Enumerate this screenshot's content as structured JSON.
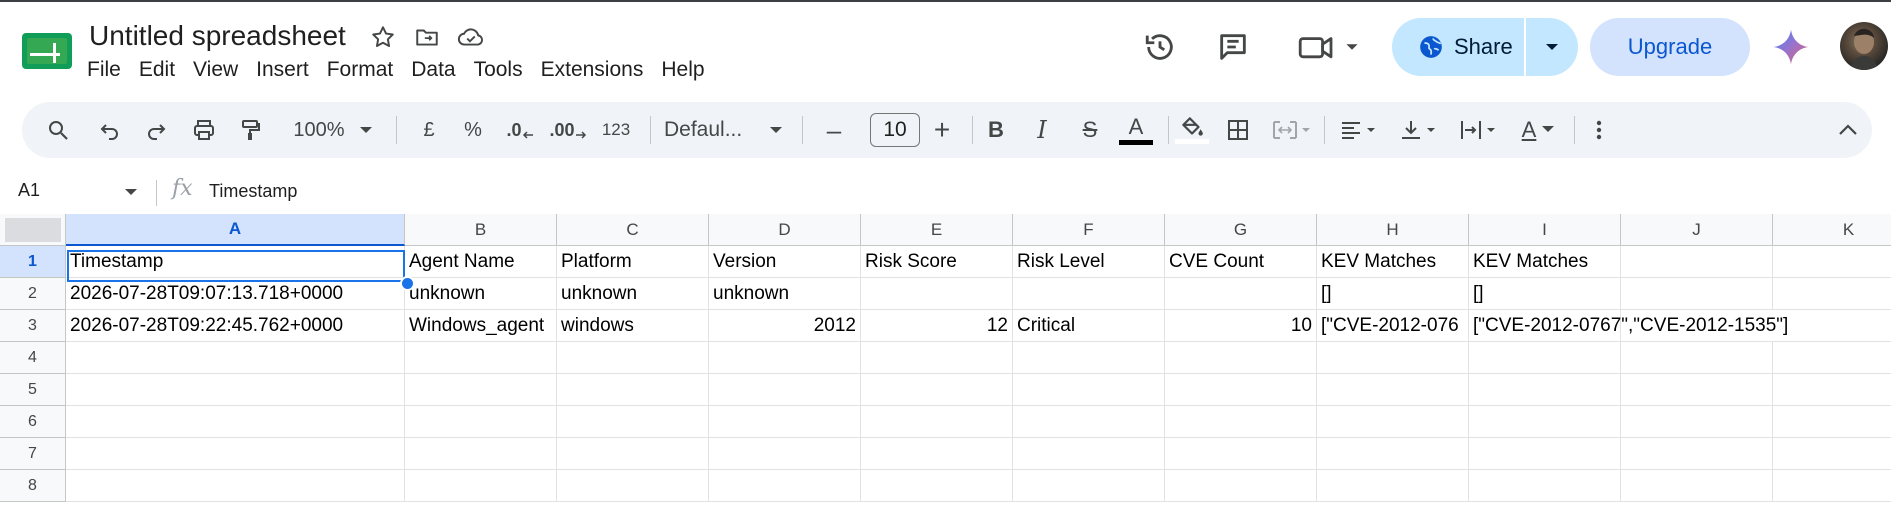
{
  "app": {
    "doc_title": "Untitled spreadsheet",
    "menu": [
      "File",
      "Edit",
      "View",
      "Insert",
      "Format",
      "Data",
      "Tools",
      "Extensions",
      "Help"
    ],
    "share_label": "Share",
    "upgrade_label": "Upgrade"
  },
  "toolbar": {
    "zoom": "100%",
    "currency": "£",
    "percent": "%",
    "dec_decrease": ".0",
    "dec_increase": ".00",
    "number_format": "123",
    "font": "Defaul...",
    "font_size": "10",
    "minus": "–",
    "plus": "+",
    "bold": "B",
    "italic": "I",
    "strike": "S",
    "text_color": "A",
    "text_rotate": "A"
  },
  "formula_bar": {
    "name_box": "A1",
    "fx": "fx",
    "value": "Timestamp"
  },
  "columns": [
    "A",
    "B",
    "C",
    "D",
    "E",
    "F",
    "G",
    "H",
    "I",
    "J",
    "K"
  ],
  "rows": [
    "1",
    "2",
    "3",
    "4",
    "5",
    "6",
    "7",
    "8"
  ],
  "cells": {
    "r1": [
      "Timestamp",
      "Agent Name",
      "Platform",
      "Version",
      "Risk Score",
      "Risk Level",
      "CVE Count",
      "KEV Matches",
      "KEV Matches",
      "",
      ""
    ],
    "r2": [
      "2026-07-28T09:07:13.718+0000",
      "unknown",
      "unknown",
      "unknown",
      "",
      "",
      "",
      "[]",
      "[]",
      "",
      ""
    ],
    "r3": [
      "2026-07-28T09:22:45.762+0000",
      "Windows_agent",
      "windows",
      "2012",
      "12",
      "Critical",
      "10",
      "[\"CVE-2012-076",
      "[\"CVE-2012-0767\",\"CVE-2012-1535\"]",
      "",
      ""
    ]
  },
  "colors": {
    "accent": "#0b57d0",
    "share_bg": "#c2e7ff",
    "upgrade_bg": "#d3e3fd",
    "selection": "#1a73e8",
    "sheets_green": "#0f9d58"
  }
}
